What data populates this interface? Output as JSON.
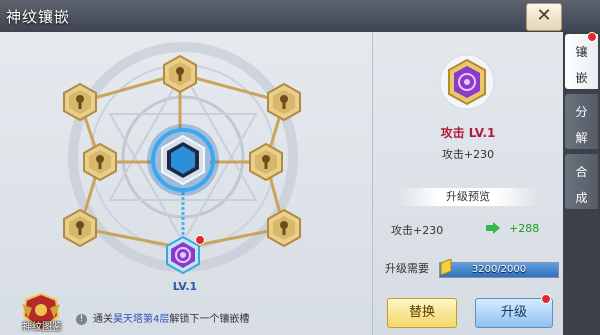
{
  "window": {
    "title": "神纹镶嵌",
    "close_icon": "close-icon"
  },
  "tabs": [
    {
      "label_line1": "镶",
      "label_line2": "嵌",
      "active": true
    },
    {
      "label_line1": "分",
      "label_line2": "解",
      "active": false
    },
    {
      "label_line1": "合",
      "label_line2": "成",
      "active": false
    }
  ],
  "board": {
    "center_gem": "blue-hexagon-gem-icon",
    "locked_socket_icon": "lock-icon",
    "active_socket_level": "LV.1",
    "colors": {
      "gold": "#d4ad5c",
      "blue_glow": "#3a9be6",
      "purple": "#8a3bc9",
      "link": "#4bb2e8"
    }
  },
  "info": {
    "prefix": "通关",
    "highlight": "昊天塔第4层",
    "suffix": "解锁下一个镶嵌槽"
  },
  "emblem": {
    "label": "神纹图鉴"
  },
  "detail": {
    "gem_name": "攻击 LV.1",
    "stat": "攻击+230",
    "preview_title": "升级预览",
    "preview_from": "攻击+230",
    "preview_to": "+288",
    "need_label": "升级需要",
    "need_value": "3200/2000",
    "need_progress": 1.0,
    "replace_label": "替换",
    "upgrade_label": "升级"
  }
}
